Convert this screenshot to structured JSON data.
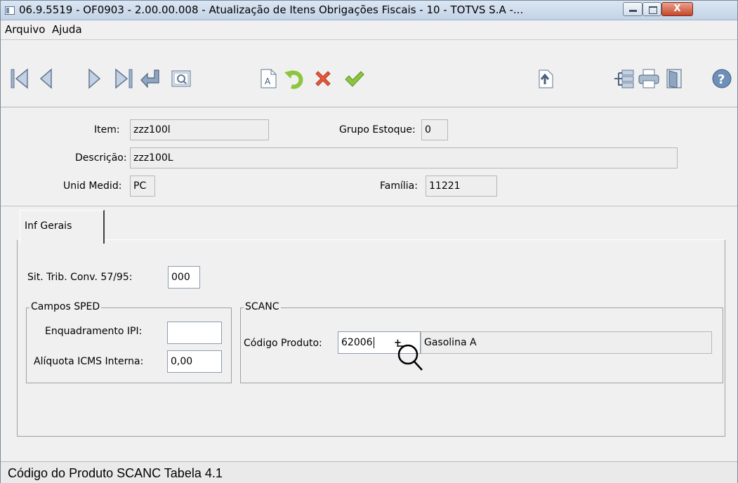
{
  "window": {
    "title": "06.9.5519 - OF0903 - 2.00.00.008 - Atualização de Itens Obrigações Fiscais - 10 - TOTVS S.A -...",
    "close_label": "X"
  },
  "menu": {
    "items": [
      "Arquivo",
      "Ajuda"
    ]
  },
  "toolbar": {
    "icons": [
      "first-record-icon",
      "previous-record-icon",
      "next-record-icon",
      "last-record-icon",
      "go-to-icon",
      "search-icon",
      "edit-icon",
      "undo-icon",
      "cancel-icon",
      "confirm-icon",
      "import-icon",
      "query-icon",
      "print-icon",
      "exit-icon",
      "help-icon"
    ]
  },
  "header": {
    "item_label": "Item:",
    "item_value": "zzz100l",
    "grupo_label": "Grupo Estoque:",
    "grupo_value": "0",
    "descricao_label": "Descrição:",
    "descricao_value": "zzz100L",
    "unid_label": "Unid Medid:",
    "unid_value": "PC",
    "familia_label": "Família:",
    "familia_value": "11221"
  },
  "tabs": [
    {
      "label": "Inf Gerais"
    }
  ],
  "inf_gerais": {
    "sit_trib_label": "Sit. Trib. Conv. 57/95:",
    "sit_trib_value": "000",
    "sped": {
      "title": "Campos SPED",
      "enquadramento_label": "Enquadramento IPI:",
      "enquadramento_value": "",
      "aliquota_label": "Alíquota ICMS Interna:",
      "aliquota_value": "0,00"
    },
    "scanc": {
      "title": "SCANC",
      "codigo_label": "Código Produto:",
      "codigo_value": "62006",
      "descricao_value": "Gasolina A",
      "zoom_hint": "+"
    }
  },
  "status_bar": {
    "text": "Código do Produto SCANC Tabela 4.1"
  }
}
